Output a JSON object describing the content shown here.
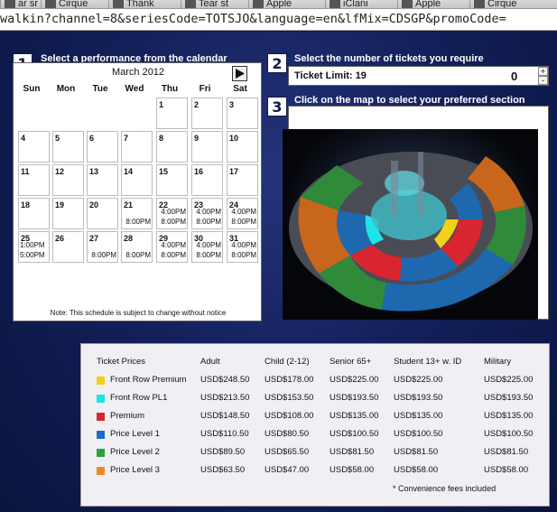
{
  "browser": {
    "tabs": [
      {
        "label": "ar sr",
        "icon": "ruler-icon"
      },
      {
        "label": "Cirque",
        "icon": "cirque-icon"
      },
      {
        "label": "Thank",
        "icon": "p-icon"
      },
      {
        "label": "Tear st",
        "icon": "tear-icon"
      },
      {
        "label": "Apple",
        "icon": "apple-icon"
      },
      {
        "label": "iClani",
        "icon": "c-icon"
      },
      {
        "label": "Apple",
        "icon": "apple-icon"
      },
      {
        "label": "Cirque",
        "icon": "cirque-icon"
      }
    ],
    "url": "walkin?channel=8&seriesCode=TOTSJO&language=en&lfMix=CDSGP&promoCode="
  },
  "steps": {
    "step1": {
      "num": "1",
      "title": "Select a performance from the calendar"
    },
    "step2": {
      "num": "2",
      "title": "Select the number of tickets you require"
    },
    "step3": {
      "num": "3",
      "title": "Click on the map to select your preferred section"
    }
  },
  "calendar": {
    "month": "March 2012",
    "next_icon": "next-arrow-icon",
    "weekdays": [
      "Sun",
      "Mon",
      "Tue",
      "Wed",
      "Thu",
      "Fri",
      "Sat"
    ],
    "weeks": [
      [
        null,
        null,
        null,
        null,
        {
          "d": "1"
        },
        {
          "d": "2"
        },
        {
          "d": "3"
        }
      ],
      [
        {
          "d": "4"
        },
        {
          "d": "5"
        },
        {
          "d": "6"
        },
        {
          "d": "7"
        },
        {
          "d": "8"
        },
        {
          "d": "9"
        },
        {
          "d": "10"
        }
      ],
      [
        {
          "d": "11"
        },
        {
          "d": "12"
        },
        {
          "d": "13"
        },
        {
          "d": "14"
        },
        {
          "d": "15"
        },
        {
          "d": "16"
        },
        {
          "d": "17"
        }
      ],
      [
        {
          "d": "18"
        },
        {
          "d": "19"
        },
        {
          "d": "20"
        },
        {
          "d": "21",
          "shows": [
            "",
            "8:00PM"
          ]
        },
        {
          "d": "22",
          "shows": [
            "4:00PM",
            "8:00PM"
          ]
        },
        {
          "d": "23",
          "shows": [
            "4:00PM",
            "8:00PM"
          ]
        },
        {
          "d": "24",
          "shows": [
            "4:00PM",
            "8:00PM"
          ]
        }
      ],
      [
        {
          "d": "25",
          "shows": [
            "1:00PM",
            "5:00PM"
          ],
          "left": true
        },
        {
          "d": "26"
        },
        {
          "d": "27",
          "shows": [
            "",
            "8:00PM"
          ]
        },
        {
          "d": "28",
          "shows": [
            "",
            "8:00PM"
          ]
        },
        {
          "d": "29",
          "shows": [
            "4:00PM",
            "8:00PM"
          ]
        },
        {
          "d": "30",
          "shows": [
            "4:00PM",
            "8:00PM"
          ]
        },
        {
          "d": "31",
          "shows": [
            "4:00PM",
            "8:00PM"
          ]
        }
      ]
    ],
    "note": "Note: This schedule is subject to change without notice"
  },
  "tickets": {
    "limit_label": "Ticket Limit: 19",
    "quantity": "0",
    "plus": "+",
    "minus": "-"
  },
  "prices": {
    "headers": [
      "Ticket Prices",
      "Adult",
      "Child (2-12)",
      "Senior 65+",
      "Student 13+ w. ID",
      "Military"
    ],
    "rows": [
      {
        "name": "Front Row Premium",
        "color": "#f2d11a",
        "adult": "USD$248.50",
        "child": "USD$178.00",
        "senior": "USD$225.00",
        "student": "USD$225.00",
        "military": "USD$225.00"
      },
      {
        "name": "Front Row PL1",
        "color": "#1ee3e8",
        "adult": "USD$213.50",
        "child": "USD$153.50",
        "senior": "USD$193.50",
        "student": "USD$193.50",
        "military": "USD$193.50"
      },
      {
        "name": "Premium",
        "color": "#d9252f",
        "adult": "USD$148.50",
        "child": "USD$108.00",
        "senior": "USD$135.00",
        "student": "USD$135.00",
        "military": "USD$135.00"
      },
      {
        "name": "Price Level 1",
        "color": "#1b6cc4",
        "adult": "USD$110.50",
        "child": "USD$80.50",
        "senior": "USD$100.50",
        "student": "USD$100.50",
        "military": "USD$100.50"
      },
      {
        "name": "Price Level 2",
        "color": "#2fa03c",
        "adult": "USD$89.50",
        "child": "USD$65.50",
        "senior": "USD$81.50",
        "student": "USD$81.50",
        "military": "USD$81.50"
      },
      {
        "name": "Price Level 3",
        "color": "#ec8a2a",
        "adult": "USD$63.50",
        "child": "USD$47.00",
        "senior": "USD$58.00",
        "student": "USD$58.00",
        "military": "USD$58.00"
      }
    ],
    "note": "* Convenience fees included"
  }
}
